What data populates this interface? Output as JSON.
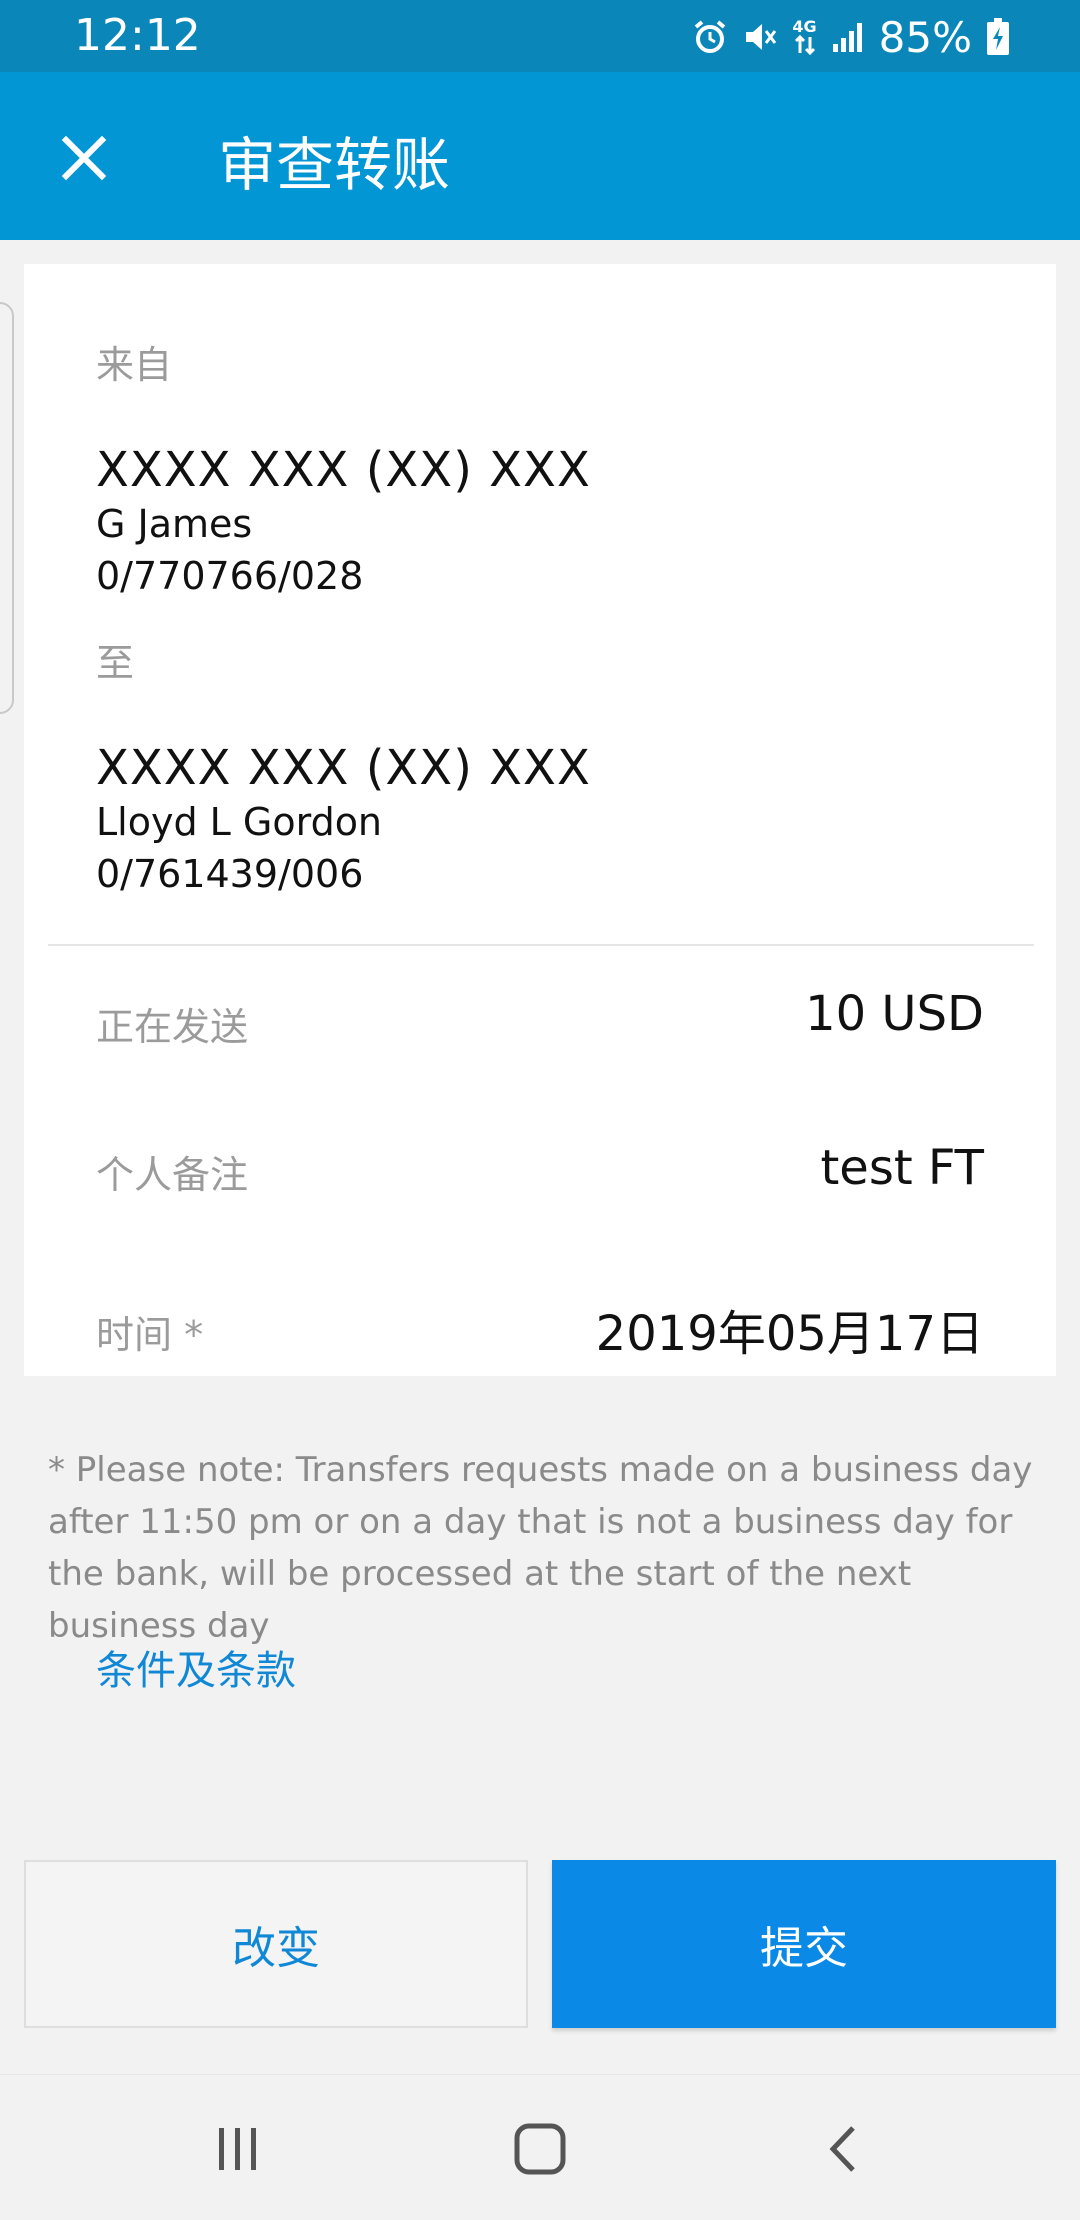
{
  "status_bar": {
    "time": "12:12",
    "network": "4G",
    "battery": "85%",
    "icons": [
      "alarm-icon",
      "mute-icon",
      "network-4g-icon",
      "signal-icon",
      "battery-charging-icon"
    ]
  },
  "app_bar": {
    "title": "审查转账",
    "close_icon": "close-icon"
  },
  "transfer": {
    "from_label": "来自",
    "from_account_mask": "XXXX XXX (XX) XXX",
    "from_name": "G James",
    "from_number": "0/770766/028",
    "to_label": "至",
    "to_account_mask": "XXXX XXX (XX) XXX",
    "to_name": "Lloyd L Gordon",
    "to_number": "0/761439/006"
  },
  "details": [
    {
      "label": "正在发送",
      "value": "10 USD"
    },
    {
      "label": "个人备注",
      "value": "test FT"
    },
    {
      "label": "时间 *",
      "value": "2019年05月17日"
    }
  ],
  "note": "* Please note: Transfers requests made on a business day after 11:50 pm or on a day that is not a business day for the bank, will be processed at the start of the next business day",
  "terms_link": "条件及条款",
  "buttons": {
    "change": "改变",
    "submit": "提交"
  },
  "colors": {
    "status_bar": "#0a87b8",
    "app_bar": "#0396d4",
    "accent": "#0a89e6",
    "link": "#1188d6"
  }
}
